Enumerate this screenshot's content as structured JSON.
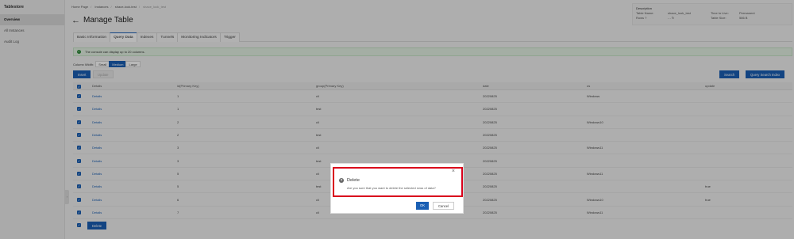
{
  "sidebar": {
    "brand": "Tablestore",
    "items": [
      {
        "label": "Overview",
        "active": true
      },
      {
        "label": "All Instances",
        "active": false
      },
      {
        "label": "Audit Log",
        "active": false
      }
    ]
  },
  "breadcrumb": [
    "Home Page",
    "Instances",
    "shace-look-test",
    "shace_look_test"
  ],
  "page_title": "Manage Table",
  "description": {
    "label": "Description",
    "table_name_key": "Table Name:",
    "table_name_val": "shace_look_test",
    "rows_key": "Rows",
    "rows_val": "- -",
    "ttl_key": "Time to Live:",
    "ttl_val": "Permanent",
    "size_key": "Table Size:",
    "size_val": "586 B"
  },
  "tabs": [
    {
      "label": "Basic Information",
      "active": false
    },
    {
      "label": "Query Data",
      "active": true
    },
    {
      "label": "Indexes",
      "active": false
    },
    {
      "label": "Tunnels",
      "active": false
    },
    {
      "label": "Monitoring Indicators",
      "active": false
    },
    {
      "label": "Trigger",
      "active": false
    }
  ],
  "alert_text": "The console can display up to 20 columns.",
  "column_width": {
    "label": "Column Width:",
    "options": [
      "Small",
      "Medium",
      "Large"
    ],
    "selected": "Medium"
  },
  "toolbar": {
    "insert": "Insert",
    "update": "Update",
    "search": "Search",
    "query_search_index": "Query Search Index"
  },
  "table": {
    "columns": [
      "",
      "Details",
      "id(Primary Key)",
      "group(Primary Key)",
      "date",
      "os",
      "update"
    ],
    "rows": [
      [
        "Details",
        "1",
        "cli",
        "20220825",
        "Windows",
        ""
      ],
      [
        "Details",
        "1",
        "test",
        "20220825",
        "",
        ""
      ],
      [
        "Details",
        "2",
        "cli",
        "20220825",
        "Windows10",
        ""
      ],
      [
        "Details",
        "2",
        "test",
        "20220825",
        "",
        ""
      ],
      [
        "Details",
        "3",
        "cli",
        "20220825",
        "Windows11",
        ""
      ],
      [
        "Details",
        "3",
        "test",
        "20220825",
        "",
        ""
      ],
      [
        "Details",
        "5",
        "cli",
        "20220825",
        "Windows11",
        ""
      ],
      [
        "Details",
        "5",
        "test",
        "20220825",
        "",
        "true"
      ],
      [
        "Details",
        "6",
        "cli",
        "20220825",
        "Windows10",
        "true"
      ],
      [
        "Details",
        "7",
        "cli",
        "20220825",
        "Windows11",
        ""
      ]
    ],
    "footer_delete": "Delete"
  },
  "dialog": {
    "title": "Delete",
    "message": "Are you sure that you want to delete the selected rows of data?",
    "ok": "OK",
    "cancel": "Cancel"
  },
  "colors": {
    "primary": "#1a5fb4",
    "highlight": "#d9001b",
    "success": "#2e8b3a"
  }
}
